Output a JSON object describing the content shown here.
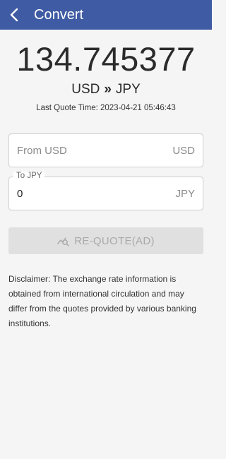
{
  "header": {
    "title": "Convert",
    "back_icon": "chevron-left-icon"
  },
  "rate": {
    "value": "134.745377",
    "from_currency": "USD",
    "separator": "»",
    "to_currency": "JPY",
    "last_quote_time": "Last Quote Time: 2023-04-21 05:46:43"
  },
  "from_field": {
    "placeholder": "From USD",
    "suffix": "USD"
  },
  "to_field": {
    "label": "To JPY",
    "value": "0",
    "suffix": "JPY"
  },
  "requote_button": {
    "label": "RE-QUOTE(AD)",
    "icon": "chart-search-icon"
  },
  "disclaimer": "Disclaimer: The exchange rate information is obtained from international circulation and may differ from the quotes provided by various banking institutions.",
  "colors": {
    "app_bar": "#3f5ba3",
    "button_disabled_bg": "#e0e0e0",
    "button_disabled_text": "#a9a9a9"
  }
}
